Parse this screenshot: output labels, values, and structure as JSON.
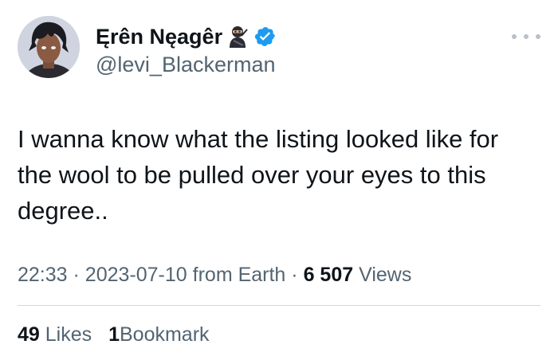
{
  "author": {
    "display_name": "Ęrên Nęagêr",
    "name_emoji": "ninja-emoji",
    "verified_icon": "verified-badge-icon",
    "verified_color": "#1d9bf0",
    "handle": "@levi_Blackerman"
  },
  "tweet": {
    "text": "I wanna know what the listing looked like for\nthe wool to be pulled over your eyes to this\ndegree.."
  },
  "meta": {
    "time": "22:33",
    "separator": "·",
    "date": "2023-07-10",
    "source": "from Earth",
    "views_count": "6 507",
    "views_label": "Views"
  },
  "stats": {
    "likes_count": "49",
    "likes_label": "Likes",
    "bookmarks_count": "1",
    "bookmarks_label": "Bookmark"
  },
  "icons": {
    "more": "more-options-icon"
  },
  "colors": {
    "text_primary": "#0f1419",
    "text_secondary": "#536471",
    "divider": "#cfd9de"
  }
}
